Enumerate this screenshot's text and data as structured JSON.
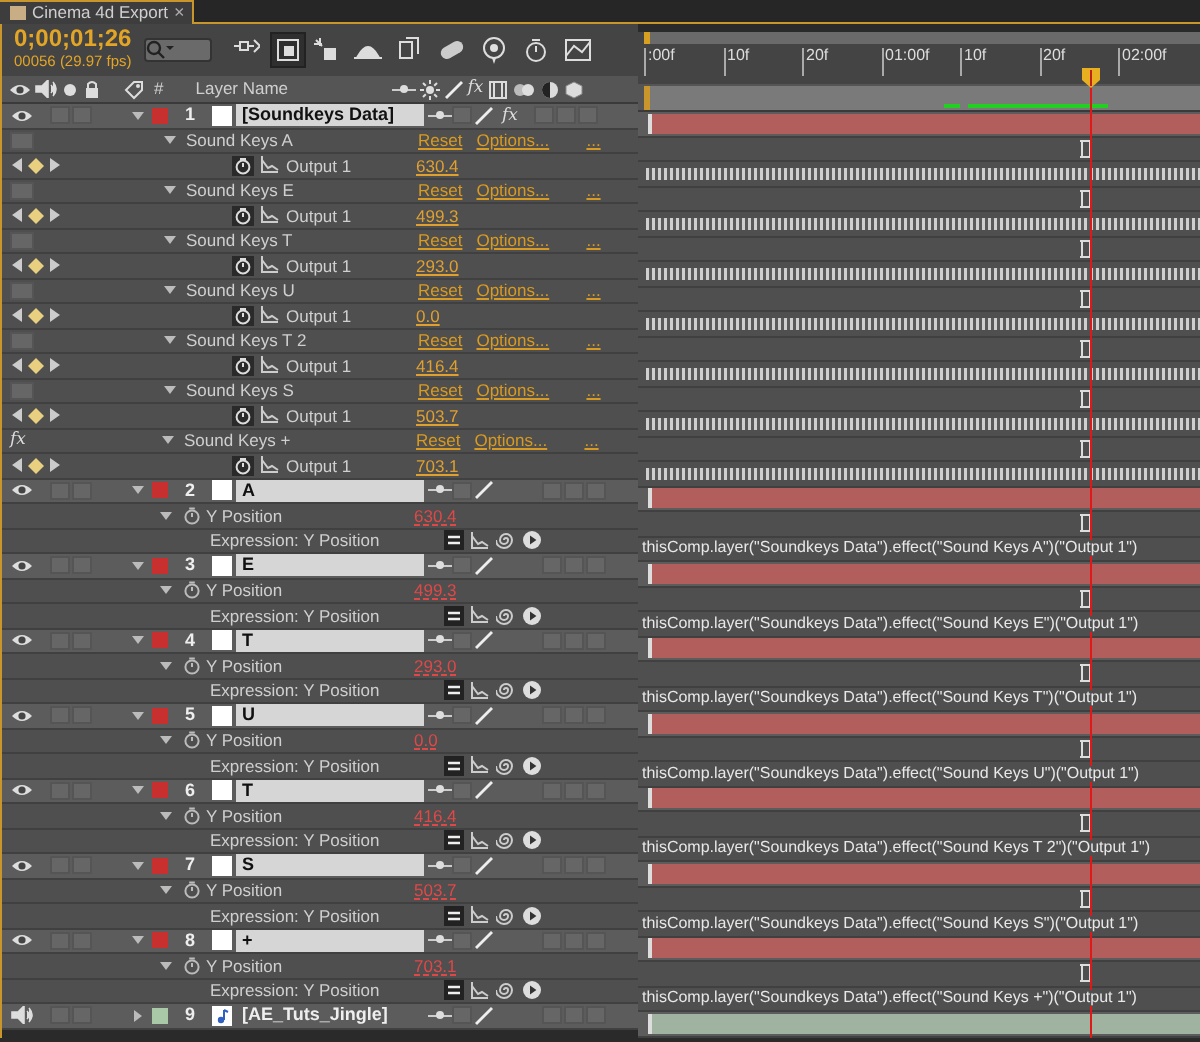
{
  "tab": {
    "title": "Cinema 4d Export",
    "close": "×"
  },
  "timecode": "0;00;01;26",
  "frame_info": "00056 (29.97 fps)",
  "ruler": [
    ":00f",
    "10f",
    "20f",
    "01:00f",
    "10f",
    "20f",
    "02:00f"
  ],
  "header": {
    "number": "#",
    "name": "Layer Name",
    "fx": "fx"
  },
  "layers": [
    {
      "number": "1",
      "name": "[Soundkeys Data]",
      "kind": "solid",
      "color": "#c8302f",
      "expanded": true,
      "selected": true,
      "fx": "fx",
      "effects": [
        {
          "name": "Sound Keys A",
          "reset": "Reset",
          "options": "Options...",
          "more": "...",
          "output": "Output 1",
          "value": "630.4"
        },
        {
          "name": "Sound Keys E",
          "reset": "Reset",
          "options": "Options...",
          "more": "...",
          "output": "Output 1",
          "value": "499.3"
        },
        {
          "name": "Sound Keys T",
          "reset": "Reset",
          "options": "Options...",
          "more": "...",
          "output": "Output 1",
          "value": "293.0"
        },
        {
          "name": "Sound Keys U",
          "reset": "Reset",
          "options": "Options...",
          "more": "...",
          "output": "Output 1",
          "value": "0.0"
        },
        {
          "name": "Sound Keys T 2",
          "reset": "Reset",
          "options": "Options...",
          "more": "...",
          "output": "Output 1",
          "value": "416.4"
        },
        {
          "name": "Sound Keys S",
          "reset": "Reset",
          "options": "Options...",
          "more": "...",
          "output": "Output 1",
          "value": "503.7"
        },
        {
          "name": "Sound Keys +",
          "reset": "Reset",
          "options": "Options...",
          "more": "...",
          "fx": "fx",
          "output": "Output 1",
          "value": "703.1"
        }
      ]
    },
    {
      "number": "2",
      "name": "A",
      "kind": "solid",
      "color": "#c8302f",
      "expanded": true,
      "selected": true,
      "property": {
        "name": "Y Position",
        "value": "630.4",
        "expression_label": "Expression: Y Position",
        "expression": "thisComp.layer(\"Soundkeys Data\").effect(\"Sound Keys A\")(\"Output 1\")"
      }
    },
    {
      "number": "3",
      "name": "E",
      "kind": "solid",
      "color": "#c8302f",
      "expanded": true,
      "selected": true,
      "property": {
        "name": "Y Position",
        "value": "499.3",
        "expression_label": "Expression: Y Position",
        "expression": "thisComp.layer(\"Soundkeys Data\").effect(\"Sound Keys E\")(\"Output 1\")"
      }
    },
    {
      "number": "4",
      "name": "T",
      "kind": "solid",
      "color": "#c8302f",
      "expanded": true,
      "selected": true,
      "property": {
        "name": "Y Position",
        "value": "293.0",
        "expression_label": "Expression: Y Position",
        "expression": "thisComp.layer(\"Soundkeys Data\").effect(\"Sound Keys T\")(\"Output 1\")"
      }
    },
    {
      "number": "5",
      "name": "U",
      "kind": "solid",
      "color": "#c8302f",
      "expanded": true,
      "selected": true,
      "property": {
        "name": "Y Position",
        "value": "0.0",
        "expression_label": "Expression: Y Position",
        "expression": "thisComp.layer(\"Soundkeys Data\").effect(\"Sound Keys U\")(\"Output 1\")"
      }
    },
    {
      "number": "6",
      "name": "T",
      "kind": "solid",
      "color": "#c8302f",
      "expanded": true,
      "selected": true,
      "property": {
        "name": "Y Position",
        "value": "416.4",
        "expression_label": "Expression: Y Position",
        "expression": "thisComp.layer(\"Soundkeys Data\").effect(\"Sound Keys T 2\")(\"Output 1\")"
      }
    },
    {
      "number": "7",
      "name": "S",
      "kind": "solid",
      "color": "#c8302f",
      "expanded": true,
      "selected": true,
      "property": {
        "name": "Y Position",
        "value": "503.7",
        "expression_label": "Expression: Y Position",
        "expression": "thisComp.layer(\"Soundkeys Data\").effect(\"Sound Keys S\")(\"Output 1\")"
      }
    },
    {
      "number": "8",
      "name": "+",
      "kind": "solid",
      "color": "#c8302f",
      "expanded": true,
      "selected": true,
      "property": {
        "name": "Y Position",
        "value": "703.1",
        "expression_label": "Expression: Y Position",
        "expression": "thisComp.layer(\"Soundkeys Data\").effect(\"Sound Keys +\")(\"Output 1\")"
      }
    },
    {
      "number": "9",
      "name": "[AE_Tuts_Jingle]",
      "kind": "audio",
      "color": "#a8c8a8",
      "expanded": false,
      "selected": false
    }
  ]
}
